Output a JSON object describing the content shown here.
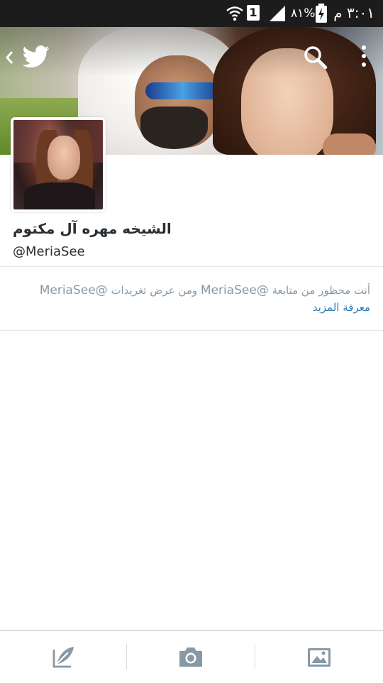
{
  "status_bar": {
    "time": "٣:٠١ م",
    "battery": "٨١%",
    "sim": "1"
  },
  "header": {
    "back_icon": "chevron-left-icon",
    "logo_icon": "twitter-bird-icon",
    "search_icon": "search-icon",
    "overflow_icon": "overflow-menu-icon"
  },
  "profile": {
    "display_name": "الشيخه مهره آل مكتوم",
    "handle": "@MeriaSee"
  },
  "protected_notice": {
    "text_prefix": "أنت محظور من متابعة ",
    "handle_1": "@MeriaSee",
    "text_middle": " ومن عرض تغريدات ",
    "handle_2": "@MeriaSee",
    "learn_more": "معرفة المزيد"
  },
  "bottom_bar": {
    "items": [
      "compose-icon",
      "camera-icon",
      "gallery-icon"
    ]
  },
  "colors": {
    "link": "#2b7bb9",
    "muted_text": "#8899a6",
    "primary_text": "#292f33",
    "status_bar_bg": "#1c1c1c",
    "icon_gray": "#8899a6"
  }
}
